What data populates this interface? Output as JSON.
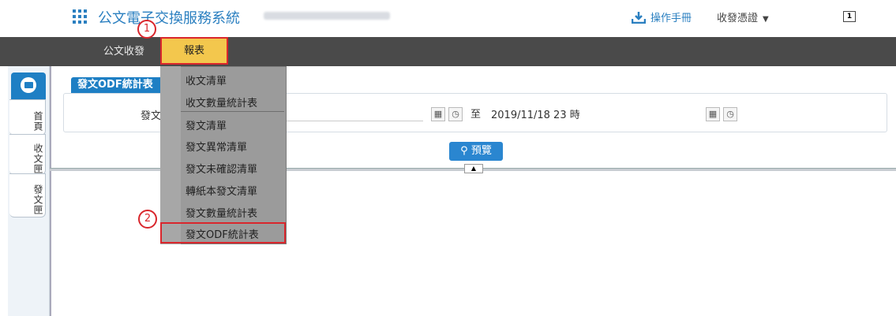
{
  "header": {
    "app_title": "公文電子交換服務系統",
    "manual_label": "操作手冊",
    "cert_label": "收發憑證",
    "cert_arrow": "▼",
    "user_icon_label": "1"
  },
  "nav": {
    "items": [
      {
        "label": "公文收發"
      },
      {
        "label": "報表"
      }
    ]
  },
  "sidebar": {
    "tabs": [
      {
        "label": "首頁"
      },
      {
        "label": "收文匣"
      },
      {
        "label": "發文匣"
      }
    ]
  },
  "main": {
    "section_title": "發文ODF統計表",
    "send_label": "發文",
    "to_label": "至",
    "end_value": "2019/11/18 23 時",
    "preview_label": "預覽"
  },
  "dropdown": {
    "items": [
      {
        "label": "收文清單"
      },
      {
        "label": "收文數量統計表"
      },
      {
        "label": "發文清單"
      },
      {
        "label": "發文異常清單"
      },
      {
        "label": "發文未確認清單"
      },
      {
        "label": "轉紙本發文清單"
      },
      {
        "label": "發文數量統計表"
      },
      {
        "label": "發文ODF統計表"
      }
    ]
  },
  "steps": {
    "one": "1",
    "two": "2"
  },
  "colors": {
    "accent": "#1e7fc4",
    "highlight": "#f3c74d",
    "annotation": "#d9262c",
    "navbar": "#4a4a4a"
  }
}
